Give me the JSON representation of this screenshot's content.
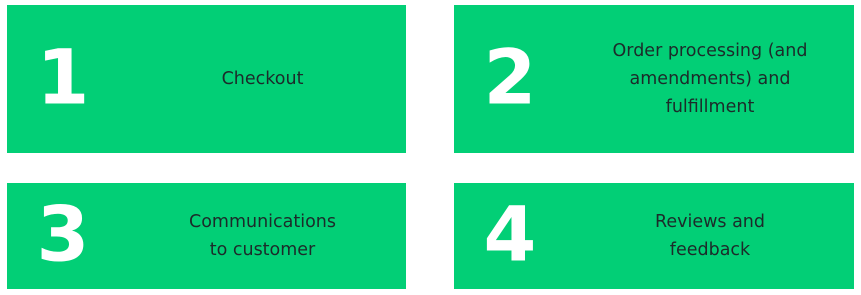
{
  "steps": [
    {
      "number": "1",
      "lines": [
        "Checkout"
      ]
    },
    {
      "number": "2",
      "lines": [
        "Order processing (and",
        "amendments) and",
        "fulfillment"
      ]
    },
    {
      "number": "3",
      "lines": [
        "Communications",
        "to customer"
      ]
    },
    {
      "number": "4",
      "lines": [
        "Reviews and",
        "feedback"
      ]
    }
  ],
  "colors": {
    "card_background": "#02cf76",
    "number": "#ffffff",
    "text": "#1c2b2a"
  }
}
